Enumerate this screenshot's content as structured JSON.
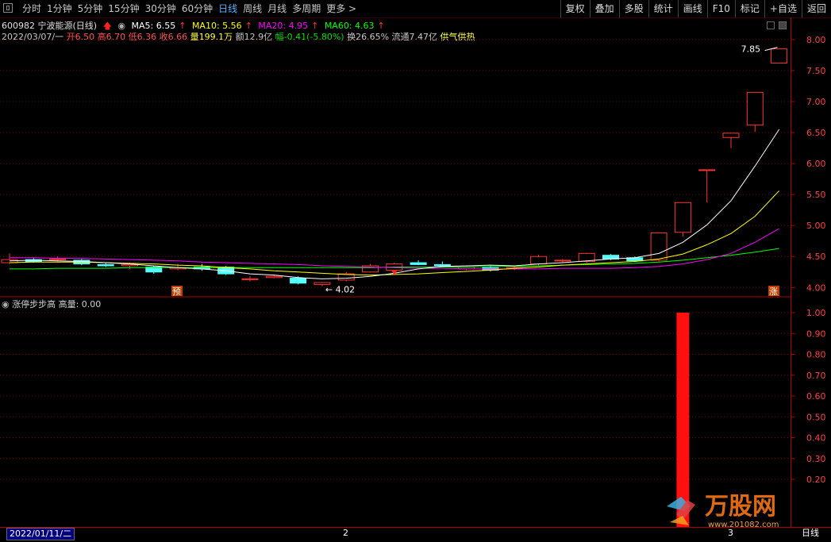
{
  "tabs": [
    "分时",
    "1分钟",
    "5分钟",
    "15分钟",
    "30分钟",
    "60分钟",
    "日线",
    "周线",
    "月线",
    "多周期",
    "更多 >"
  ],
  "active_tab": "日线",
  "right_buttons": [
    "复权",
    "叠加",
    "多股",
    "统计",
    "画线",
    "F10",
    "标记",
    "+自选",
    "返回"
  ],
  "stock": {
    "code_name": "600982 宁波能源(日线)",
    "ma5": "MA5: 6.55",
    "ma10": "MA10: 5.56",
    "ma20": "MA20: 4.95",
    "ma60": "MA60: 4.63"
  },
  "info": {
    "date": "2022/03/07/一",
    "open": "开6.50",
    "high": "高6.70",
    "low": "低6.36",
    "close": "收6.66",
    "vol": "量199.1万",
    "amount": "额12.9亿",
    "change": "幅-0.41(-5.80%)",
    "turnover": "换26.65%",
    "float_cap": "流通7.47亿",
    "tag": "供气供热"
  },
  "indicator": {
    "title": "涨停步步高",
    "value": "高量: 0.00"
  },
  "bottom": {
    "date": "2022/01/11/二",
    "mark_2": "2",
    "mark_3": "3",
    "period": "日线"
  },
  "annotations": {
    "high_label": "7.85",
    "low_label": "4.02",
    "yu_badge": "预",
    "zhang_badge": "涨"
  },
  "colors": {
    "up": "#ff3232",
    "down": "#54ffff",
    "ma5": "#ffffff",
    "ma10": "#ffff00",
    "ma20": "#ff00ff",
    "ma60": "#00ff00",
    "grid": "#800000"
  },
  "chart_data": [
    {
      "type": "candlestick",
      "ylim": [
        3.85,
        8.05
      ],
      "yticks": [
        "8.00",
        "7.50",
        "7.00",
        "6.50",
        "6.00",
        "5.50",
        "5.00",
        "4.50",
        "4.00"
      ],
      "candles": [
        {
          "o": 4.4,
          "h": 4.55,
          "l": 4.38,
          "c": 4.45
        },
        {
          "o": 4.45,
          "h": 4.48,
          "l": 4.4,
          "c": 4.42
        },
        {
          "o": 4.45,
          "h": 4.5,
          "l": 4.42,
          "c": 4.46
        },
        {
          "o": 4.44,
          "h": 4.46,
          "l": 4.36,
          "c": 4.38
        },
        {
          "o": 4.37,
          "h": 4.4,
          "l": 4.33,
          "c": 4.35
        },
        {
          "o": 4.35,
          "h": 4.4,
          "l": 4.3,
          "c": 4.37
        },
        {
          "o": 4.33,
          "h": 4.35,
          "l": 4.22,
          "c": 4.25
        },
        {
          "o": 4.3,
          "h": 4.38,
          "l": 4.28,
          "c": 4.32
        },
        {
          "o": 4.33,
          "h": 4.38,
          "l": 4.27,
          "c": 4.3
        },
        {
          "o": 4.33,
          "h": 4.35,
          "l": 4.2,
          "c": 4.22
        },
        {
          "o": 4.14,
          "h": 4.18,
          "l": 4.1,
          "c": 4.14
        },
        {
          "o": 4.16,
          "h": 4.2,
          "l": 4.15,
          "c": 4.18
        },
        {
          "o": 4.15,
          "h": 4.18,
          "l": 4.05,
          "c": 4.07
        },
        {
          "o": 4.05,
          "h": 4.08,
          "l": 4.02,
          "c": 4.08
        },
        {
          "o": 4.12,
          "h": 4.25,
          "l": 4.1,
          "c": 4.22
        },
        {
          "o": 4.25,
          "h": 4.38,
          "l": 4.24,
          "c": 4.35
        },
        {
          "o": 4.28,
          "h": 4.4,
          "l": 4.2,
          "c": 4.38
        },
        {
          "o": 4.4,
          "h": 4.44,
          "l": 4.36,
          "c": 4.37
        },
        {
          "o": 4.37,
          "h": 4.42,
          "l": 4.34,
          "c": 4.35
        },
        {
          "o": 4.3,
          "h": 4.34,
          "l": 4.28,
          "c": 4.33
        },
        {
          "o": 4.32,
          "h": 4.35,
          "l": 4.26,
          "c": 4.28
        },
        {
          "o": 4.3,
          "h": 4.34,
          "l": 4.28,
          "c": 4.32
        },
        {
          "o": 4.38,
          "h": 4.52,
          "l": 4.36,
          "c": 4.5
        },
        {
          "o": 4.44,
          "h": 4.46,
          "l": 4.4,
          "c": 4.44
        },
        {
          "o": 4.42,
          "h": 4.56,
          "l": 4.4,
          "c": 4.55
        },
        {
          "o": 4.52,
          "h": 4.54,
          "l": 4.44,
          "c": 4.46
        },
        {
          "o": 4.48,
          "h": 4.5,
          "l": 4.41,
          "c": 4.43
        },
        {
          "o": 4.44,
          "h": 4.88,
          "l": 4.42,
          "c": 4.88
        },
        {
          "o": 4.89,
          "h": 5.37,
          "l": 4.82,
          "c": 5.37
        },
        {
          "o": 5.9,
          "h": 5.9,
          "l": 5.37,
          "c": 5.9
        },
        {
          "o": 6.42,
          "h": 6.49,
          "l": 6.25,
          "c": 6.49
        },
        {
          "o": 6.62,
          "h": 7.15,
          "l": 6.51,
          "c": 7.15
        },
        {
          "o": 7.62,
          "h": 7.85,
          "l": 7.62,
          "c": 7.85
        }
      ],
      "ma5": [
        4.43,
        4.44,
        4.43,
        4.42,
        4.4,
        4.38,
        4.35,
        4.32,
        4.3,
        4.27,
        4.22,
        4.2,
        4.16,
        4.14,
        4.15,
        4.18,
        4.23,
        4.3,
        4.34,
        4.35,
        4.36,
        4.35,
        4.38,
        4.4,
        4.43,
        4.46,
        4.48,
        4.55,
        4.73,
        5.01,
        5.4,
        5.96,
        6.55
      ],
      "ma10": [
        4.4,
        4.41,
        4.41,
        4.41,
        4.4,
        4.39,
        4.38,
        4.36,
        4.35,
        4.32,
        4.3,
        4.27,
        4.25,
        4.23,
        4.21,
        4.2,
        4.21,
        4.22,
        4.24,
        4.26,
        4.28,
        4.31,
        4.33,
        4.36,
        4.38,
        4.4,
        4.42,
        4.46,
        4.54,
        4.69,
        4.87,
        5.15,
        5.56
      ],
      "ma20": [
        4.48,
        4.48,
        4.47,
        4.47,
        4.46,
        4.45,
        4.44,
        4.43,
        4.41,
        4.4,
        4.39,
        4.38,
        4.37,
        4.35,
        4.34,
        4.33,
        4.32,
        4.31,
        4.31,
        4.3,
        4.3,
        4.3,
        4.3,
        4.31,
        4.31,
        4.31,
        4.32,
        4.34,
        4.38,
        4.45,
        4.55,
        4.73,
        4.95
      ],
      "ma60": [
        4.3,
        4.3,
        4.31,
        4.31,
        4.31,
        4.32,
        4.32,
        4.32,
        4.32,
        4.32,
        4.32,
        4.32,
        4.32,
        4.32,
        4.32,
        4.32,
        4.33,
        4.33,
        4.33,
        4.33,
        4.34,
        4.34,
        4.35,
        4.36,
        4.37,
        4.38,
        4.39,
        4.41,
        4.44,
        4.48,
        4.52,
        4.57,
        4.63
      ]
    },
    {
      "type": "bar",
      "ylim": [
        0,
        1.05
      ],
      "yticks": [
        "1.00",
        "0.90",
        "0.80",
        "0.70",
        "0.60",
        "0.50",
        "0.40",
        "0.30",
        "0.20"
      ],
      "values_index": 28,
      "value": 1.0
    }
  ]
}
